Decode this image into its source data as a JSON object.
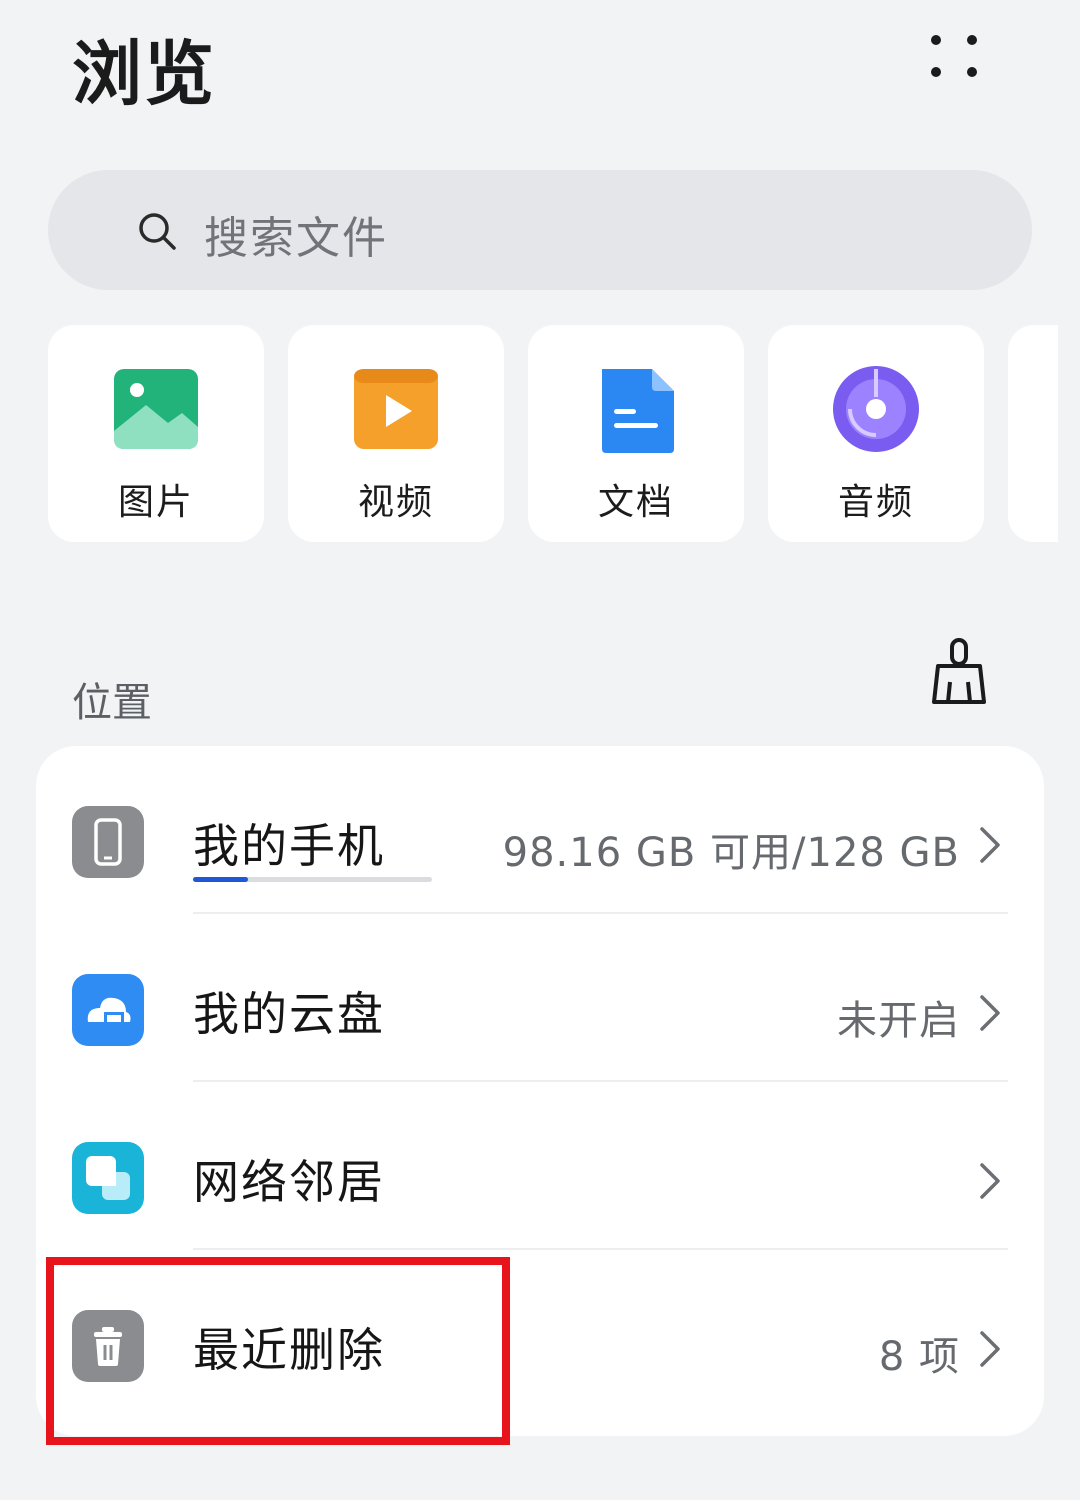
{
  "header": {
    "title": "浏览"
  },
  "search": {
    "placeholder": "搜索文件"
  },
  "categories": [
    {
      "label": "图片",
      "icon": "image-icon"
    },
    {
      "label": "视频",
      "icon": "video-icon"
    },
    {
      "label": "文档",
      "icon": "document-icon"
    },
    {
      "label": "音频",
      "icon": "audio-icon"
    }
  ],
  "locations": {
    "label": "位置",
    "items": [
      {
        "title": "我的手机",
        "value": "98.16 GB 可用/128 GB",
        "icon": "phone-icon",
        "storage_used_fraction": 0.23
      },
      {
        "title": "我的云盘",
        "value": "未开启",
        "icon": "cloud-icon"
      },
      {
        "title": "网络邻居",
        "value": "",
        "icon": "network-icon"
      },
      {
        "title": "最近删除",
        "value": "8 项",
        "icon": "trash-icon"
      }
    ]
  },
  "colors": {
    "background": "#f1f3f5",
    "accent": "#1e57d8",
    "highlight": "#e8141c"
  }
}
